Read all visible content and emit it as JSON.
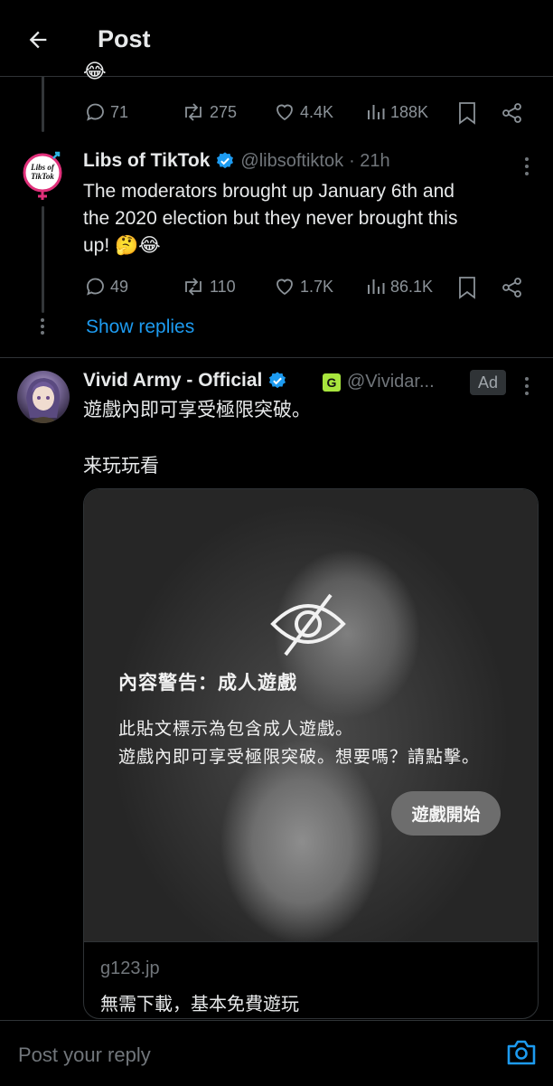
{
  "header": {
    "title": "Post",
    "back_icon": "arrow-left-icon"
  },
  "prev_tweet": {
    "emoji": "😂",
    "actions": {
      "replies": "71",
      "reposts": "275",
      "likes": "4.4K",
      "views": "188K"
    }
  },
  "libs_tweet": {
    "name": "Libs of TikTok",
    "handle": "@libsoftiktok",
    "time": "· 21h",
    "avatar_text_line1": "Libs of",
    "avatar_text_line2": "TikTok",
    "text_line1": "The moderators brought up January 6th and",
    "text_line2": "the 2020 election but they never brought this",
    "text_line3": "up! 🤔😂",
    "actions": {
      "replies": "49",
      "reposts": "110",
      "likes": "1.7K",
      "views": "86.1K"
    },
    "show_replies": "Show replies"
  },
  "ad_tweet": {
    "name": "Vivid Army - Official",
    "affiliate_badge": "G",
    "handle": "@Vividar...",
    "ad_label": "Ad",
    "text_line1": "遊戲內即可享受極限突破。",
    "text_line2": "来玩玩看",
    "card": {
      "warning_title": "內容警告：成人遊戲",
      "warning_line1": "此貼文標示為包含成人遊戲。",
      "warning_line2": "遊戲內即可享受極限突破。想要嗎？請點擊。",
      "button_label": "遊戲開始",
      "domain": "g123.jp",
      "description": "無需下載，基本免費遊玩"
    }
  },
  "reply_bar": {
    "placeholder": "Post your reply",
    "camera_icon": "camera-icon"
  },
  "colors": {
    "background": "#000000",
    "accent": "#1d9bf0",
    "muted": "#71767b",
    "verified": "#1d9bf0",
    "badge": "#a8e63d"
  }
}
